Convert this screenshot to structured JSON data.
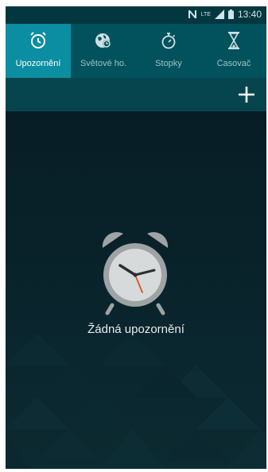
{
  "status": {
    "carrier_icon": "n-icon",
    "network": "LTE",
    "time": "13:40"
  },
  "tabs": [
    {
      "label": "Upozornění",
      "icon": "alarm-clock-icon",
      "active": true
    },
    {
      "label": "Světové ho.",
      "icon": "globe-clock-icon",
      "active": false
    },
    {
      "label": "Stopky",
      "icon": "stopwatch-icon",
      "active": false
    },
    {
      "label": "Časovač",
      "icon": "hourglass-icon",
      "active": false
    }
  ],
  "actions": {
    "add_icon": "plus-icon"
  },
  "empty_state": {
    "message": "Žádná upozornění",
    "icon": "alarm-clock-icon"
  },
  "colors": {
    "active_tab": "#0b8ea1",
    "tab_bar": "#01525d",
    "status_bar": "#03373f",
    "background": "#071d25"
  }
}
